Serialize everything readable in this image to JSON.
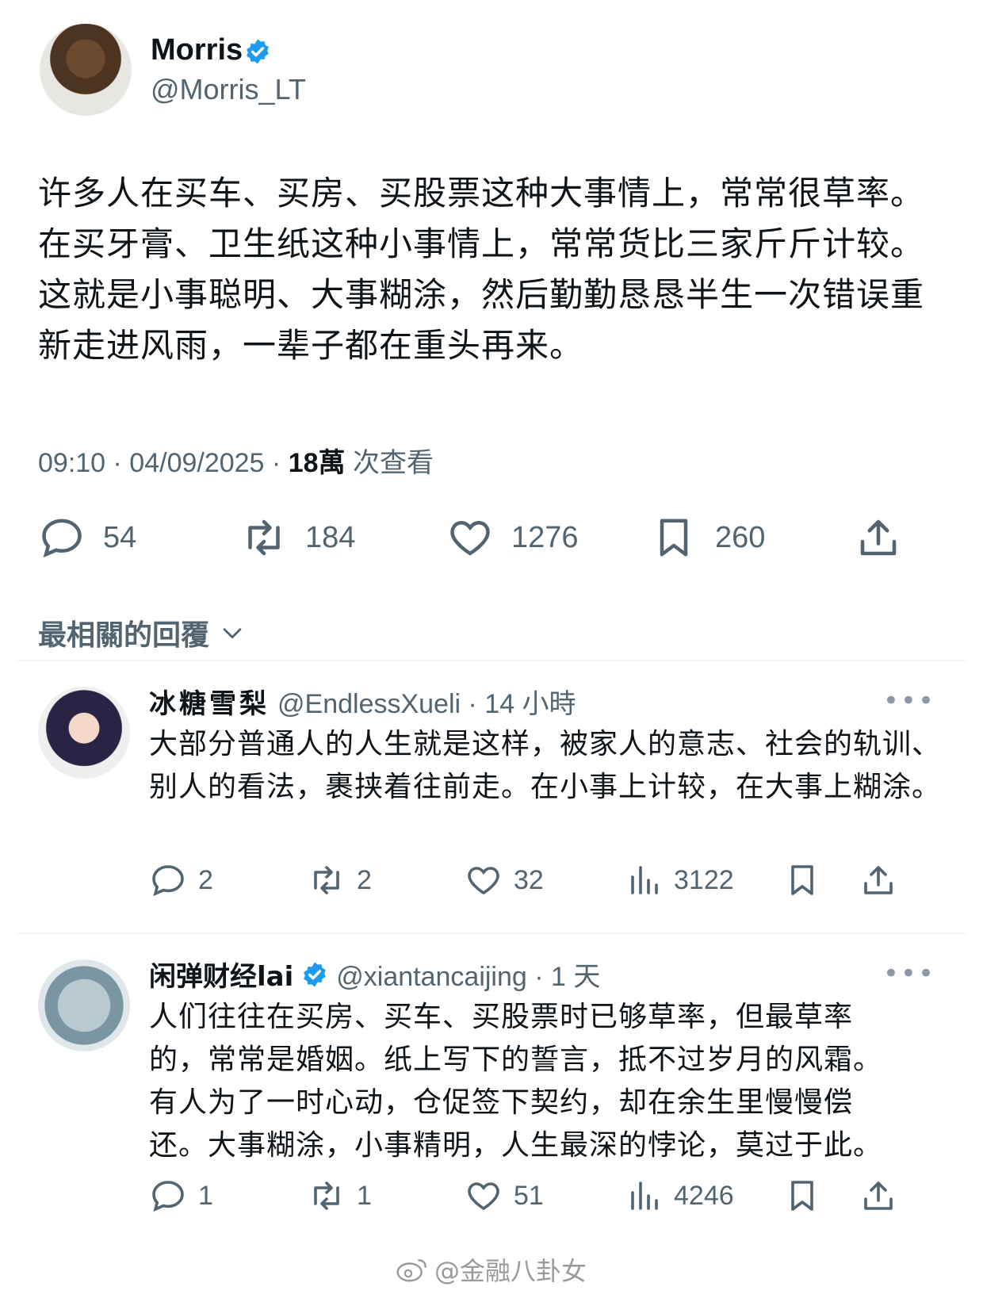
{
  "post": {
    "name": "Morris",
    "handle": "@Morris_LT",
    "text": "许多人在买车、买房、买股票这种大事情上，常常很草率。在买牙膏、卫生纸这种小事情上，常常货比三家斤斤计较。这就是小事聪明、大事糊涂，然后勤勤恳恳半生一次错误重新走进风雨，一辈子都在重头再来。",
    "time": "09:10 · 04/09/2025 · ",
    "views": "18萬",
    "views_label": " 次查看",
    "replies": "54",
    "reposts": "184",
    "likes": "1276",
    "bookmarks": "260"
  },
  "sort_label": "最相關的回覆",
  "replies": [
    {
      "name": "冰糖雪梨",
      "handle": "@EndlessXueli · 14 小時",
      "more": "•••",
      "text": "大部分普通人的人生就是这样，被家人的意志、社会的轨训、别人的看法，裹挟着往前走。在小事上计较，在大事上糊涂。",
      "replies": "2",
      "reposts": "2",
      "likes": "32",
      "views": "3122"
    },
    {
      "name": "闲弹财经lai",
      "handle": "@xiantancaijing · 1 天",
      "more": "•••",
      "text": "人们往往在买房、买车、买股票时已够草率，但最草率的，常常是婚姻。纸上写下的誓言，抵不过岁月的风霜。有人为了一时心动，仓促签下契约，却在余生里慢慢偿还。大事糊涂，小事精明，人生最深的悖论，莫过于此。",
      "replies": "1",
      "reposts": "1",
      "likes": "51",
      "views": "4246"
    }
  ],
  "watermark": "@金融八卦女",
  "colors": {
    "accent": "#1d9bf0",
    "muted": "#536471",
    "text": "#0f1419"
  }
}
